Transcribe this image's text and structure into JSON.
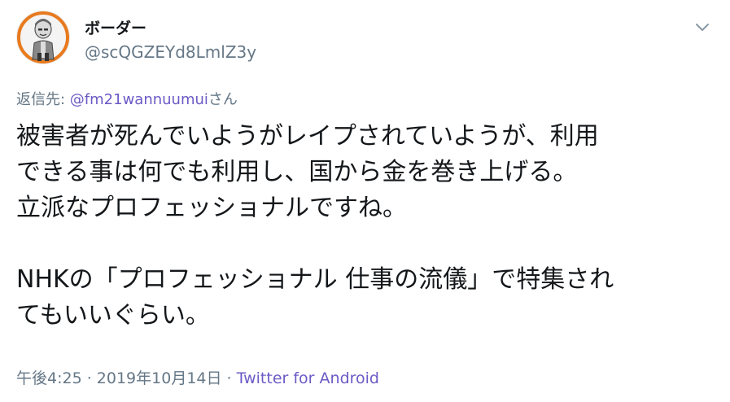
{
  "user": {
    "display_name": "ボーダー",
    "handle": "@scQGZEYd8LmlZ3y"
  },
  "reply": {
    "prefix": "返信先: ",
    "mention": "@fm21wannuumui",
    "suffix": "さん"
  },
  "tweet": {
    "lines": [
      "被害者が死んでいようがレイプされていようが、利用",
      "できる事は何でも利用し、国から金を巻き上げる。",
      "立派なプロフェッショナルですね。",
      "",
      "NHKの「プロフェッショナル 仕事の流儀」で特集され",
      "てもいいぐらい。"
    ]
  },
  "meta": {
    "time": "午後4:25",
    "sep1": " · ",
    "date": "2019年10月14日",
    "sep2": " · ",
    "source": "Twitter for Android"
  },
  "icons": {
    "caret": "chevron-down-icon",
    "avatar": "avatar-illustration"
  },
  "colors": {
    "link": "#6c5ac6",
    "secondary_text": "#657786",
    "primary_text": "#14171a",
    "avatar_ring": "#e87a1e"
  }
}
